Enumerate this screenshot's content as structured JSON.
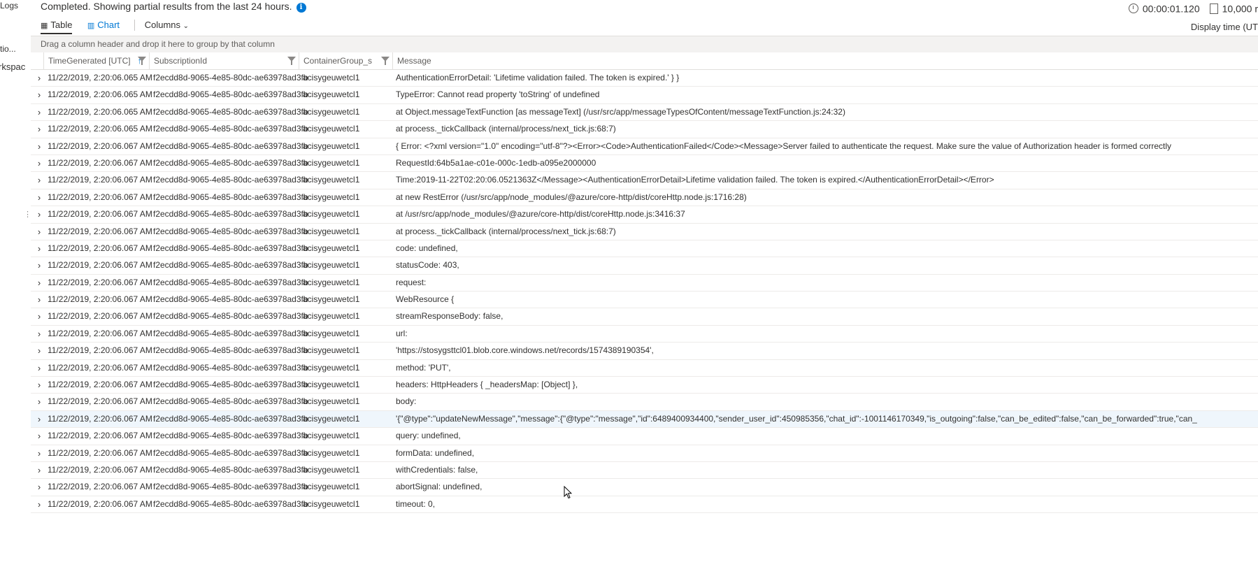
{
  "nav": {
    "items": [
      "Logs",
      "tio...",
      "rkspac"
    ]
  },
  "status": {
    "text": "Completed. Showing partial results from the last 24 hours."
  },
  "metrics": {
    "duration": "00:00:01.120",
    "records": "10,000 r"
  },
  "tabs": {
    "table": "Table",
    "chart": "Chart",
    "columns": "Columns"
  },
  "display_time": "Display time (UT",
  "group_hint": "Drag a column header and drop it here to group by that column",
  "columns": [
    "TimeGenerated [UTC]",
    "SubscriptionId",
    "ContainerGroup_s",
    "Message"
  ],
  "colors": {
    "accent": "#0078d4",
    "row_highlight": "#eff6fc"
  },
  "rows": [
    {
      "time": "11/22/2019, 2:20:06.065 AM",
      "sub": "f2ecdd8d-9065-4e85-80dc-ae63978ad3fb",
      "cg": "acisygeuwetcl1",
      "msg": "AuthenticationErrorDetail: 'Lifetime validation failed. The token is expired.' } }"
    },
    {
      "time": "11/22/2019, 2:20:06.065 AM",
      "sub": "f2ecdd8d-9065-4e85-80dc-ae63978ad3fb",
      "cg": "acisygeuwetcl1",
      "msg": "TypeError: Cannot read property 'toString' of undefined"
    },
    {
      "time": "11/22/2019, 2:20:06.065 AM",
      "sub": "f2ecdd8d-9065-4e85-80dc-ae63978ad3fb",
      "cg": "acisygeuwetcl1",
      "msg": "at Object.messageTextFunction [as messageText] (/usr/src/app/messageTypesOfContent/messageTextFunction.js:24:32)"
    },
    {
      "time": "11/22/2019, 2:20:06.065 AM",
      "sub": "f2ecdd8d-9065-4e85-80dc-ae63978ad3fb",
      "cg": "acisygeuwetcl1",
      "msg": "at process._tickCallback (internal/process/next_tick.js:68:7)"
    },
    {
      "time": "11/22/2019, 2:20:06.067 AM",
      "sub": "f2ecdd8d-9065-4e85-80dc-ae63978ad3fb",
      "cg": "acisygeuwetcl1",
      "msg": "{ Error: <?xml version=\"1.0\" encoding=\"utf-8\"?><Error><Code>AuthenticationFailed</Code><Message>Server failed to authenticate the request. Make sure the value of Authorization header is formed correctly"
    },
    {
      "time": "11/22/2019, 2:20:06.067 AM",
      "sub": "f2ecdd8d-9065-4e85-80dc-ae63978ad3fb",
      "cg": "acisygeuwetcl1",
      "msg": "RequestId:64b5a1ae-c01e-000c-1edb-a095e2000000"
    },
    {
      "time": "11/22/2019, 2:20:06.067 AM",
      "sub": "f2ecdd8d-9065-4e85-80dc-ae63978ad3fb",
      "cg": "acisygeuwetcl1",
      "msg": "Time:2019-11-22T02:20:06.0521363Z</Message><AuthenticationErrorDetail>Lifetime validation failed. The token is expired.</AuthenticationErrorDetail></Error>"
    },
    {
      "time": "11/22/2019, 2:20:06.067 AM",
      "sub": "f2ecdd8d-9065-4e85-80dc-ae63978ad3fb",
      "cg": "acisygeuwetcl1",
      "msg": "at new RestError (/usr/src/app/node_modules/@azure/core-http/dist/coreHttp.node.js:1716:28)"
    },
    {
      "time": "11/22/2019, 2:20:06.067 AM",
      "sub": "f2ecdd8d-9065-4e85-80dc-ae63978ad3fb",
      "cg": "acisygeuwetcl1",
      "msg": "at /usr/src/app/node_modules/@azure/core-http/dist/coreHttp.node.js:3416:37"
    },
    {
      "time": "11/22/2019, 2:20:06.067 AM",
      "sub": "f2ecdd8d-9065-4e85-80dc-ae63978ad3fb",
      "cg": "acisygeuwetcl1",
      "msg": "at process._tickCallback (internal/process/next_tick.js:68:7)"
    },
    {
      "time": "11/22/2019, 2:20:06.067 AM",
      "sub": "f2ecdd8d-9065-4e85-80dc-ae63978ad3fb",
      "cg": "acisygeuwetcl1",
      "msg": "code: undefined,"
    },
    {
      "time": "11/22/2019, 2:20:06.067 AM",
      "sub": "f2ecdd8d-9065-4e85-80dc-ae63978ad3fb",
      "cg": "acisygeuwetcl1",
      "msg": "statusCode: 403,"
    },
    {
      "time": "11/22/2019, 2:20:06.067 AM",
      "sub": "f2ecdd8d-9065-4e85-80dc-ae63978ad3fb",
      "cg": "acisygeuwetcl1",
      "msg": "request:"
    },
    {
      "time": "11/22/2019, 2:20:06.067 AM",
      "sub": "f2ecdd8d-9065-4e85-80dc-ae63978ad3fb",
      "cg": "acisygeuwetcl1",
      "msg": "WebResource {"
    },
    {
      "time": "11/22/2019, 2:20:06.067 AM",
      "sub": "f2ecdd8d-9065-4e85-80dc-ae63978ad3fb",
      "cg": "acisygeuwetcl1",
      "msg": "streamResponseBody: false,"
    },
    {
      "time": "11/22/2019, 2:20:06.067 AM",
      "sub": "f2ecdd8d-9065-4e85-80dc-ae63978ad3fb",
      "cg": "acisygeuwetcl1",
      "msg": "url:"
    },
    {
      "time": "11/22/2019, 2:20:06.067 AM",
      "sub": "f2ecdd8d-9065-4e85-80dc-ae63978ad3fb",
      "cg": "acisygeuwetcl1",
      "msg": "'https://stosygsttcl01.blob.core.windows.net/records/1574389190354',"
    },
    {
      "time": "11/22/2019, 2:20:06.067 AM",
      "sub": "f2ecdd8d-9065-4e85-80dc-ae63978ad3fb",
      "cg": "acisygeuwetcl1",
      "msg": "method: 'PUT',"
    },
    {
      "time": "11/22/2019, 2:20:06.067 AM",
      "sub": "f2ecdd8d-9065-4e85-80dc-ae63978ad3fb",
      "cg": "acisygeuwetcl1",
      "msg": "headers: HttpHeaders { _headersMap: [Object] },"
    },
    {
      "time": "11/22/2019, 2:20:06.067 AM",
      "sub": "f2ecdd8d-9065-4e85-80dc-ae63978ad3fb",
      "cg": "acisygeuwetcl1",
      "msg": "body:"
    },
    {
      "time": "11/22/2019, 2:20:06.067 AM",
      "sub": "f2ecdd8d-9065-4e85-80dc-ae63978ad3fb",
      "cg": "acisygeuwetcl1",
      "msg": "'{\"@type\":\"updateNewMessage\",\"message\":{\"@type\":\"message\",\"id\":6489400934400,\"sender_user_id\":450985356,\"chat_id\":-1001146170349,\"is_outgoing\":false,\"can_be_edited\":false,\"can_be_forwarded\":true,\"can_",
      "highlight": true
    },
    {
      "time": "11/22/2019, 2:20:06.067 AM",
      "sub": "f2ecdd8d-9065-4e85-80dc-ae63978ad3fb",
      "cg": "acisygeuwetcl1",
      "msg": "query: undefined,"
    },
    {
      "time": "11/22/2019, 2:20:06.067 AM",
      "sub": "f2ecdd8d-9065-4e85-80dc-ae63978ad3fb",
      "cg": "acisygeuwetcl1",
      "msg": "formData: undefined,"
    },
    {
      "time": "11/22/2019, 2:20:06.067 AM",
      "sub": "f2ecdd8d-9065-4e85-80dc-ae63978ad3fb",
      "cg": "acisygeuwetcl1",
      "msg": "withCredentials: false,"
    },
    {
      "time": "11/22/2019, 2:20:06.067 AM",
      "sub": "f2ecdd8d-9065-4e85-80dc-ae63978ad3fb",
      "cg": "acisygeuwetcl1",
      "msg": "abortSignal: undefined,"
    },
    {
      "time": "11/22/2019, 2:20:06.067 AM",
      "sub": "f2ecdd8d-9065-4e85-80dc-ae63978ad3fb",
      "cg": "acisygeuwetcl1",
      "msg": "timeout: 0,"
    }
  ]
}
